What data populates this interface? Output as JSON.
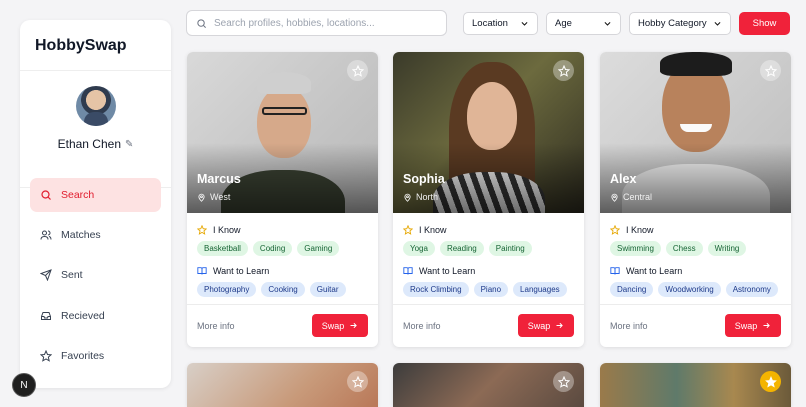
{
  "app": {
    "brand": "HobbySwap"
  },
  "user": {
    "name": "Ethan Chen"
  },
  "nav": [
    {
      "label": "Search",
      "icon": "search-icon",
      "active": true
    },
    {
      "label": "Matches",
      "icon": "users-icon",
      "active": false
    },
    {
      "label": "Sent",
      "icon": "send-icon",
      "active": false
    },
    {
      "label": "Recieved",
      "icon": "inbox-icon",
      "active": false
    },
    {
      "label": "Favorites",
      "icon": "star-icon",
      "active": false
    }
  ],
  "search": {
    "placeholder": "Search profiles, hobbies, locations...",
    "value": ""
  },
  "filters": {
    "location": "Location",
    "age": "Age",
    "category": "Hobby Category",
    "show": "Show"
  },
  "labels": {
    "i_know": "I Know",
    "want_to_learn": "Want to Learn",
    "more_info": "More info",
    "swap": "Swap"
  },
  "colors": {
    "accent": "#f0223a",
    "know_tag_bg": "#dff6e4",
    "learn_tag_bg": "#dde9fb",
    "favorite_active": "#f4b400"
  },
  "profiles": [
    {
      "name": "Marcus",
      "location": "West",
      "know": [
        "Basketball",
        "Coding",
        "Gaming"
      ],
      "learn": [
        "Photography",
        "Cooking",
        "Guitar"
      ]
    },
    {
      "name": "Sophia",
      "location": "North",
      "know": [
        "Yoga",
        "Reading",
        "Painting"
      ],
      "learn": [
        "Rock Climbing",
        "Piano",
        "Languages"
      ]
    },
    {
      "name": "Alex",
      "location": "Central",
      "know": [
        "Swimming",
        "Chess",
        "Writing"
      ],
      "learn": [
        "Dancing",
        "Woodworking",
        "Astronomy"
      ]
    }
  ],
  "floating_button": "N"
}
